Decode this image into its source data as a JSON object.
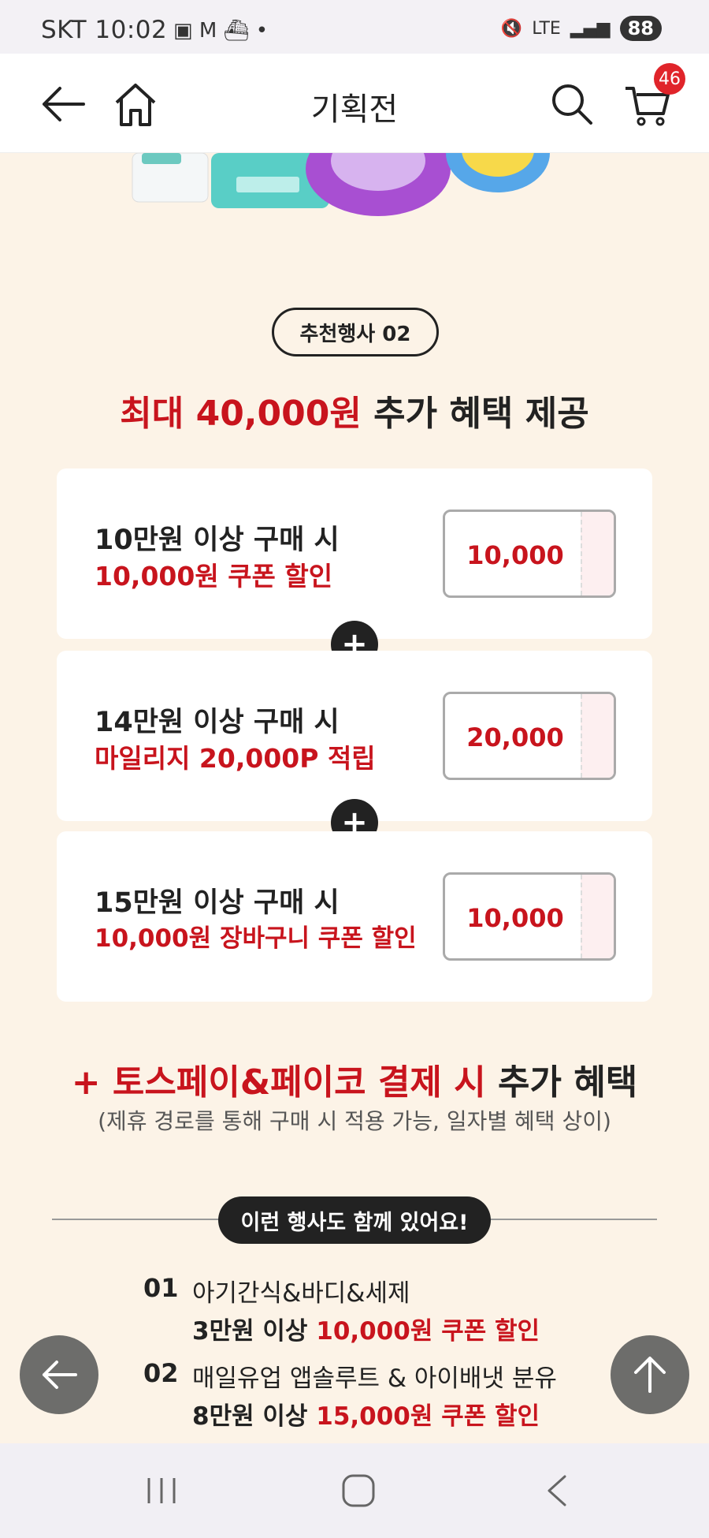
{
  "status_bar": {
    "carrier": "SKT",
    "time": "10:02",
    "network": "LTE",
    "battery": "88"
  },
  "header": {
    "title": "기획전",
    "cart_count": "46"
  },
  "event": {
    "pill": "추천행사 02",
    "headline_red": "최대 40,000원",
    "headline_rest": " 추가 혜택 제공"
  },
  "cards": [
    {
      "condition": "10만원 이상 구매 시",
      "benefit": "10,000원 쿠폰 할인",
      "ticket": "10,000"
    },
    {
      "condition": "14만원 이상 구매 시",
      "benefit": "마일리지 20,000P 적립",
      "ticket": "20,000"
    },
    {
      "condition": "15만원 이상 구매 시",
      "benefit": "10,000원 장바구니 쿠폰 할인",
      "ticket": "10,000"
    }
  ],
  "pay": {
    "red": "+ 토스페이&페이코 결제 시",
    "rest": " 추가 혜택",
    "note": "(제휴 경로를 통해 구매 시 적용 가능, 일자별 혜택 상이)"
  },
  "more": {
    "pill": "이런 행사도 함께 있어요!",
    "items": [
      {
        "num": "01",
        "name": "아기간식&바디&세제",
        "cond": "3만원 이상 ",
        "benefit": "10,000원 쿠폰 할인"
      },
      {
        "num": "02",
        "name": "매일유업 앱솔루트 & 아이배냇 분유",
        "cond": "8만원 이상 ",
        "benefit": "15,000원 쿠폰 할인"
      }
    ]
  },
  "colors": {
    "accent_red": "#c8141d",
    "background": "#fcf3e7"
  }
}
